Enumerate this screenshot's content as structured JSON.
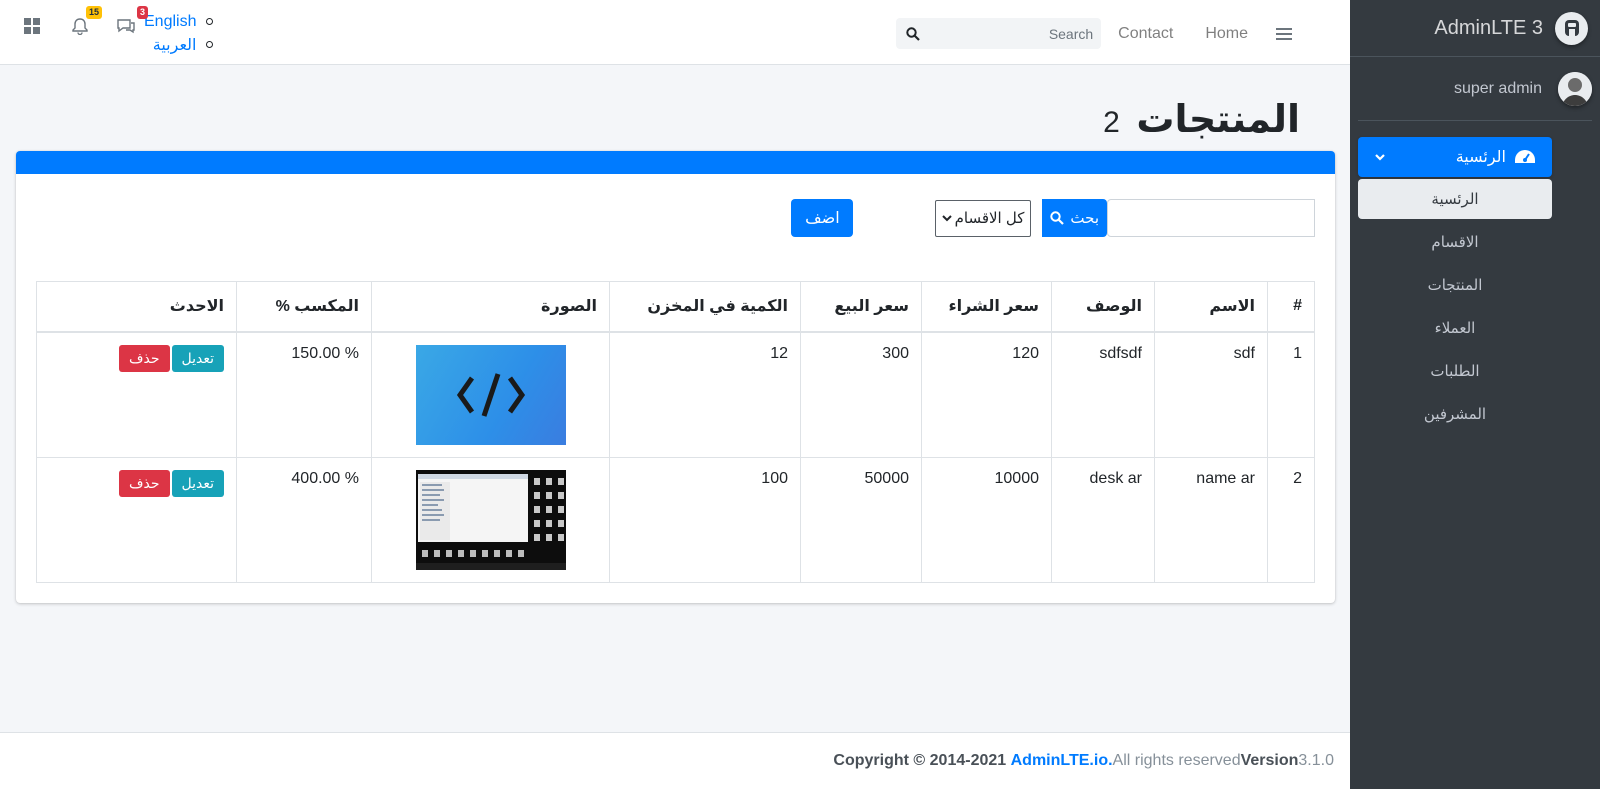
{
  "sidebar": {
    "brand": "AdminLTE 3",
    "user": "super admin",
    "nav_main": "الرئسية",
    "items": [
      "الرئسية",
      "الاقسام",
      "المنتجات",
      "العملاء",
      "الطلبات",
      "المشرفين"
    ]
  },
  "navbar": {
    "links": [
      "Home",
      "Contact"
    ],
    "search_label": "Search",
    "languages": [
      "English",
      "العربية"
    ],
    "notif_badge": "15",
    "msg_badge": "3"
  },
  "page": {
    "title": "المنتجات",
    "count": "2"
  },
  "toolbar": {
    "search_button": "بحث",
    "category_select": "كل الاقسام",
    "add_button": "اضف"
  },
  "table": {
    "headers": [
      "#",
      "الاسم",
      "الوصف",
      "سعر الشراء",
      "سعر البيع",
      "الكمية في المخزن",
      "الصورة",
      "المكسب %",
      "الاحدث"
    ],
    "rows": [
      {
        "num": "1",
        "name": "sdf",
        "desc": "sdfsdf",
        "buy": "120",
        "sell": "300",
        "qty": "12",
        "profit": "% 150.00",
        "edit": "تعديل",
        "delete": "حذف"
      },
      {
        "num": "2",
        "name": "name ar",
        "desc": "desk ar",
        "buy": "10000",
        "sell": "50000",
        "qty": "100",
        "profit": "% 400.00",
        "edit": "تعديل",
        "delete": "حذف"
      }
    ]
  },
  "footer": {
    "copyright": "Copyright © 2014-2021",
    "link": "AdminLTE.io.",
    "rights": " All rights reserved",
    "version_label": "Version",
    "version": " 3.1.0"
  }
}
